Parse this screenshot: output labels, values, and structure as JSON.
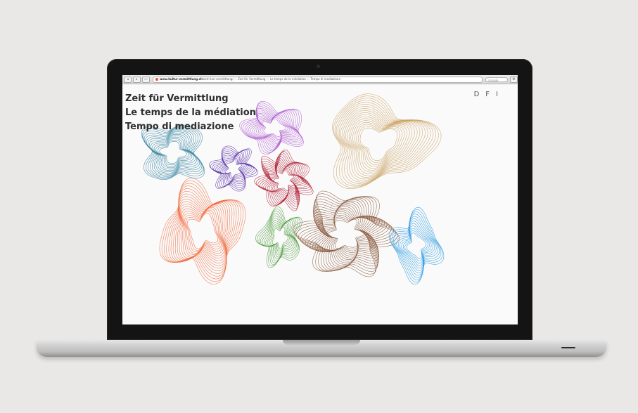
{
  "browser": {
    "back_label": "◂",
    "forward_label": "▸",
    "tabs_label": "▭",
    "url_domain": "www.kultur-vermittlung.ch",
    "url_path": "/zeit-fuer-vermittlung/ — Zeit für Vermittlung — Le temps de la médiation — Tempo di mediazione",
    "search_placeholder": "Google",
    "settings_label": "⚙"
  },
  "page": {
    "title_lines": [
      "Zeit für Vermittlung",
      "Le temps de la médiation",
      "Tempo di mediazione"
    ],
    "languages": [
      "D",
      "F",
      "I"
    ]
  },
  "artwork": {
    "shapes": [
      {
        "name": "teal-shape",
        "color": "#2e7f9e"
      },
      {
        "name": "purple-shape",
        "color": "#b05fd0"
      },
      {
        "name": "gold-shape",
        "color": "#c9a060"
      },
      {
        "name": "violet-shape",
        "color": "#5b2fa8"
      },
      {
        "name": "crimson-shape",
        "color": "#b2243a"
      },
      {
        "name": "orange-shape",
        "color": "#f06a3c"
      },
      {
        "name": "green-shape",
        "color": "#4e9a3c"
      },
      {
        "name": "brown-shape",
        "color": "#8a5a3e"
      },
      {
        "name": "blue-shape",
        "color": "#2a9be0"
      }
    ]
  }
}
